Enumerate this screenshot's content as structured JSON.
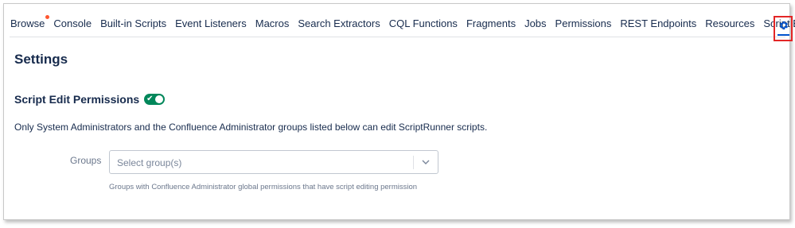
{
  "nav": {
    "items": [
      {
        "label": "Browse",
        "badge": true
      },
      {
        "label": "Console"
      },
      {
        "label": "Built-in Scripts"
      },
      {
        "label": "Event Listeners"
      },
      {
        "label": "Macros"
      },
      {
        "label": "Search Extractors"
      },
      {
        "label": "CQL Functions"
      },
      {
        "label": "Fragments"
      },
      {
        "label": "Jobs"
      },
      {
        "label": "Permissions"
      },
      {
        "label": "REST Endpoints"
      },
      {
        "label": "Resources"
      },
      {
        "label": "Script Editor"
      }
    ],
    "settings_icon": "gear-icon",
    "badge_color": "#ff5630",
    "highlight_color": "#e32626",
    "active_color": "#0052cc"
  },
  "page": {
    "title": "Settings"
  },
  "section": {
    "title": "Script Edit Permissions",
    "toggle_on": true,
    "toggle_color": "#00875a",
    "description": "Only System Administrators and the Confluence Administrator groups listed below can edit ScriptRunner scripts."
  },
  "groups": {
    "label": "Groups",
    "placeholder": "Select group(s)",
    "helper": "Groups with Confluence Administrator global permissions that have script editing permission"
  }
}
